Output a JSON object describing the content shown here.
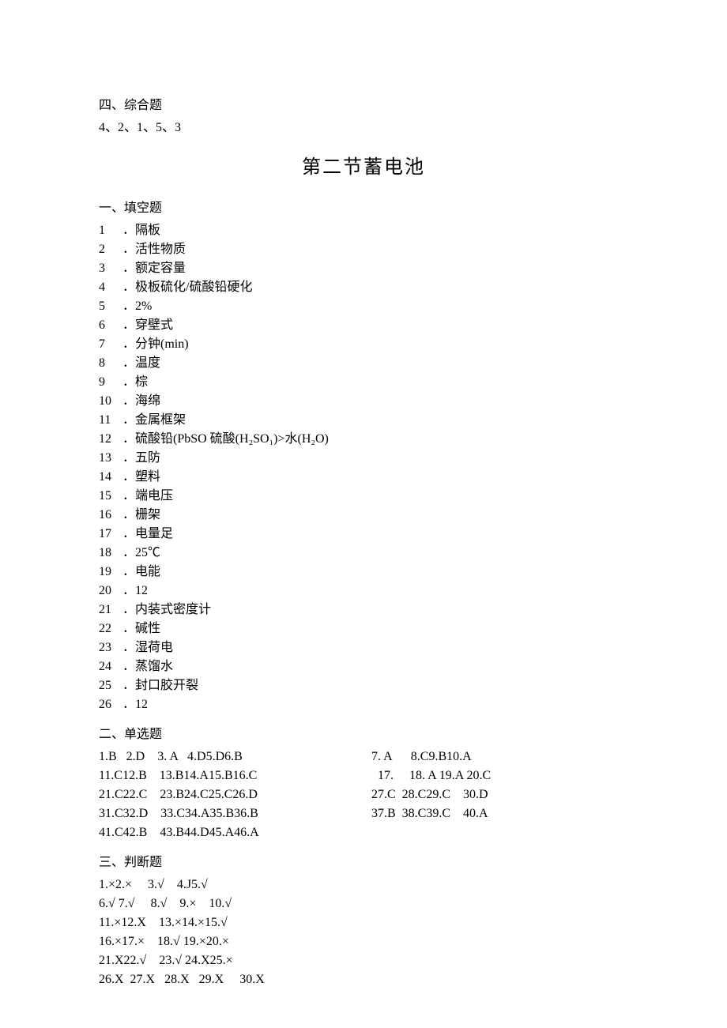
{
  "top": {
    "heading": "四、综合题",
    "sequence": "4、2、1、5、3"
  },
  "title": "第二节蓄电池",
  "fill": {
    "heading": "一、填空题",
    "items": [
      {
        "n": "1",
        "t": "．隔板"
      },
      {
        "n": "2",
        "t": "．活性物质"
      },
      {
        "n": "3",
        "t": "．额定容量"
      },
      {
        "n": "4",
        "t": "．极板硫化/硫酸铅硬化"
      },
      {
        "n": "5",
        "t": "．2%"
      },
      {
        "n": "6",
        "t": "．穿壁式"
      },
      {
        "n": "7",
        "t": "．分钟(min)"
      },
      {
        "n": "8",
        "t": "．温度"
      },
      {
        "n": "9",
        "t": "．棕"
      },
      {
        "n": "10",
        "t": "．海绵"
      },
      {
        "n": "11",
        "t": "．金属框架"
      },
      {
        "n": "12",
        "t": "．硫酸铅(PbSO 硫酸(H₂SO₁)>水(H₂O)"
      },
      {
        "n": "13",
        "t": "．五防"
      },
      {
        "n": "14",
        "t": "．塑料"
      },
      {
        "n": "15",
        "t": "．端电压"
      },
      {
        "n": "16",
        "t": "．栅架"
      },
      {
        "n": "17",
        "t": "．电量足"
      },
      {
        "n": "18",
        "t": "．25℃"
      },
      {
        "n": "19",
        "t": "．电能"
      },
      {
        "n": "20",
        "t": "．12"
      },
      {
        "n": "21",
        "t": "．内装式密度计"
      },
      {
        "n": "22",
        "t": "．碱性"
      },
      {
        "n": "23",
        "t": "．湿荷电"
      },
      {
        "n": "24",
        "t": "．蒸馏水"
      },
      {
        "n": "25",
        "t": "．封口胶开裂"
      },
      {
        "n": "26",
        "t": "．12"
      }
    ]
  },
  "mc": {
    "heading": "二、单选题",
    "rows": [
      {
        "left": "1.B   2.D    3. A   4.D5.D6.B",
        "right": "7. A      8.C9.B10.A"
      },
      {
        "left": "11.C12.B    13.B14.A15.B16.C",
        "right": "  17.     18. A 19.A 20.C"
      },
      {
        "left": "21.C22.C    23.B24.C25.C26.D",
        "right": "27.C  28.C29.C    30.D"
      },
      {
        "left": "31.C32.D    33.C34.A35.B36.B",
        "right": "37.B  38.C39.C    40.A"
      },
      {
        "left": "41.C42.B    43.B44.D45.A46.A",
        "right": ""
      }
    ]
  },
  "judge": {
    "heading": "三、判断题",
    "rows": [
      "1.×2.×     3.√    4.J5.√",
      "6.√ 7.√     8.√    9.×    10.√",
      "11.×12.X    13.×14.×15.√",
      "16.×17.×    18.√ 19.×20.×",
      "21.X22.√    23.√ 24.X25.×",
      "26.X  27.X   28.X   29.X     30.X"
    ]
  }
}
